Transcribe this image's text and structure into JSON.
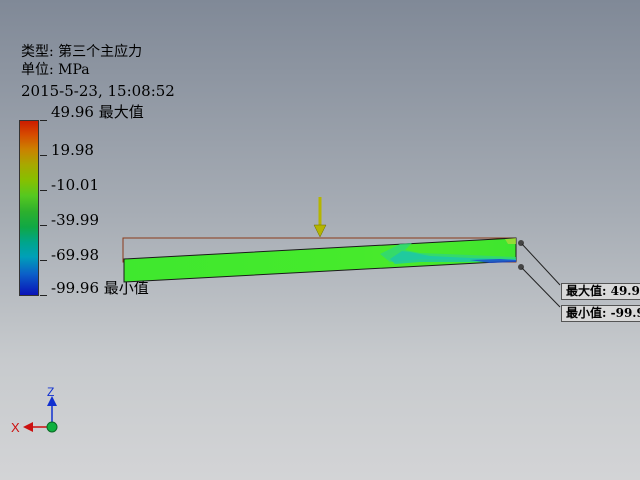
{
  "header": {
    "type_line": "类型: 第三个主应力",
    "unit_line": "单位: MPa",
    "date_line": "2015-5-23, 15:08:52"
  },
  "legend": {
    "labels": [
      "49.96 最大值",
      "19.98",
      "-10.01",
      "-39.99",
      "-69.98",
      "-99.96 最小值"
    ]
  },
  "probes": {
    "max_label": "最大值: 49.9",
    "min_label": "最小值: -99.9"
  },
  "triad": {
    "z_label": "Z",
    "x_label": "X"
  },
  "colors": {
    "max_red": "#cc1c00",
    "min_blue": "#0a12b8",
    "beam_green": "#3fe82e",
    "arrow_olive": "#b5b500",
    "axis_blue": "#1030d0",
    "axis_red": "#cc1010",
    "origin_green": "#10b040"
  }
}
